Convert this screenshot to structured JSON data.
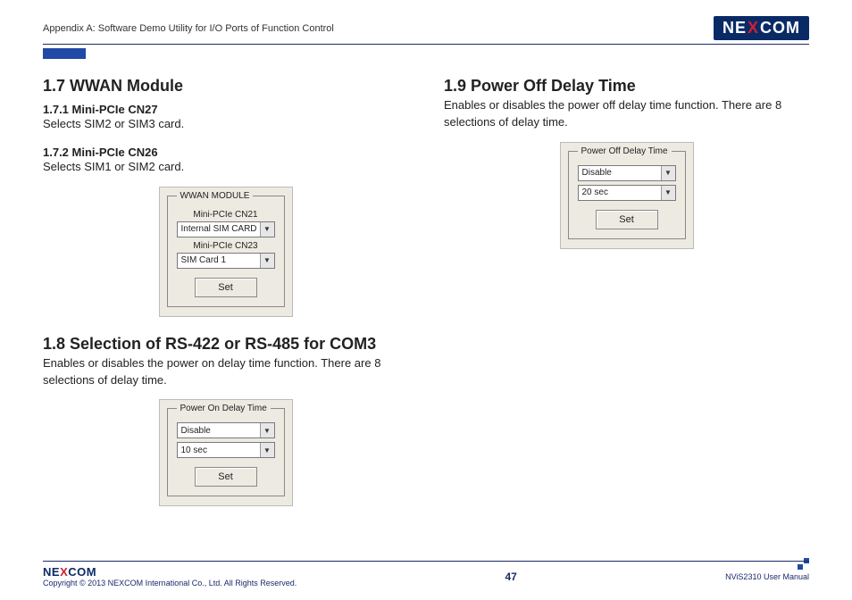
{
  "header": {
    "appendix": "Appendix A: Software Demo Utility for I/O Ports of Function Control",
    "logo_prefix": "NE",
    "logo_x": "X",
    "logo_suffix": "COM"
  },
  "left": {
    "s17_title": "1.7  WWAN Module",
    "s171_title": "1.7.1  Mini-PCIe CN27",
    "s171_body": "Selects SIM2 or SIM3 card.",
    "s172_title": "1.7.2 Mini-PCIe CN26",
    "s172_body": "Selects SIM1 or SIM2 card.",
    "panel1": {
      "legend": "WWAN MODULE",
      "label1": "Mini-PCIe CN21",
      "dd1": "Internal SIM CARD",
      "label2": "Mini-PCIe CN23",
      "dd2": "SIM Card 1",
      "set": "Set"
    },
    "s18_title": "1.8  Selection of RS-422 or RS-485 for COM3",
    "s18_body": "Enables or disables the power on delay time function. There are 8 selections of delay time.",
    "panel2": {
      "legend": "Power On Delay Time",
      "dd1": "Disable",
      "dd2": "10 sec",
      "set": "Set"
    }
  },
  "right": {
    "s19_title": "1.9  Power Off Delay Time",
    "s19_body": "Enables or disables the power off delay time function. There are 8 selections of delay time.",
    "panel3": {
      "legend": "Power Off Delay Time",
      "dd1": "Disable",
      "dd2": "20 sec",
      "set": "Set"
    }
  },
  "footer": {
    "copyright": "Copyright © 2013 NEXCOM International Co., Ltd. All Rights Reserved.",
    "page": "47",
    "manual": "NViS2310 User Manual"
  }
}
